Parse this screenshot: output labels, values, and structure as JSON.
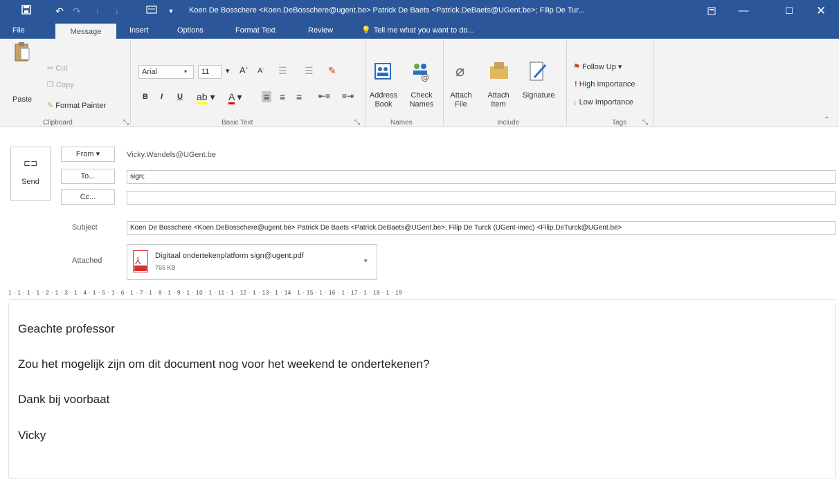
{
  "titlebar": {
    "title": "Koen De Bosschere <Koen.DeBosschere@ugent.be> Patrick De Baets <Patrick.DeBaets@UGent.be>; Filip De Tur..."
  },
  "tabs": [
    "File",
    "Message",
    "Insert",
    "Options",
    "Format Text",
    "Review"
  ],
  "tell_me": "Tell me what you want to do...",
  "ribbon": {
    "clipboard": {
      "paste": "Paste",
      "cut": "Cut",
      "copy": "Copy",
      "format_painter": "Format Painter",
      "label": "Clipboard"
    },
    "basic_text": {
      "font": "Arial",
      "size": "11",
      "label": "Basic Text",
      "bold": "B",
      "italic": "I",
      "underline": "U"
    },
    "names": {
      "address_book": "Address Book",
      "check_names": "Check Names",
      "label": "Names"
    },
    "include": {
      "attach_file": "Attach File",
      "attach_item": "Attach Item",
      "signature": "Signature",
      "label": "Include"
    },
    "tags": {
      "follow_up": "Follow Up",
      "high": "High Importance",
      "low": "Low Importance",
      "label": "Tags"
    }
  },
  "compose": {
    "send": "Send",
    "from_btn": "From",
    "from_value": "Vicky.Wandels@UGent.be",
    "to_btn": "To...",
    "to_value": "sign;",
    "cc_btn": "Cc...",
    "cc_value": "",
    "subject_label": "Subject",
    "subject_value": "Koen De Bosschere <Koen.DeBosschere@ugent.be> Patrick De Baets <Patrick.DeBaets@UGent.be>; Filip De Turck (UGent-imec) <Filip.DeTurck@UGent.be>",
    "attached_label": "Attached",
    "attachment_name": "Digitaal ondertekenplatform sign@ugent.pdf",
    "attachment_size": "765 KB"
  },
  "ruler_text": "1 · 1 · 1 · 1 · 2 · 1 · 3 · 1 · 4 · 1 · 5 · 1 · 6 · 1 · 7 · 1 · 8 · 1 · 9 · 1 · 10 · 1 · 11 · 1 · 12 · 1 · 13 · 1 · 14 · 1 · 15 · 1 · 16 · 1 · 17 · 1 · 18 · 1 · 19",
  "body": {
    "line1": "Geachte professor",
    "line2": "Zou het mogelijk zijn om dit document nog voor het weekend te ondertekenen?",
    "line3": "Dank bij voorbaat",
    "line4": "Vicky"
  },
  "colors": {
    "accent": "#2b579a",
    "ribbon_bg": "#f3f3f3",
    "pdf_red": "#d9302c",
    "flag_red": "#c43e1c",
    "low_blue": "#2b6cc4"
  }
}
